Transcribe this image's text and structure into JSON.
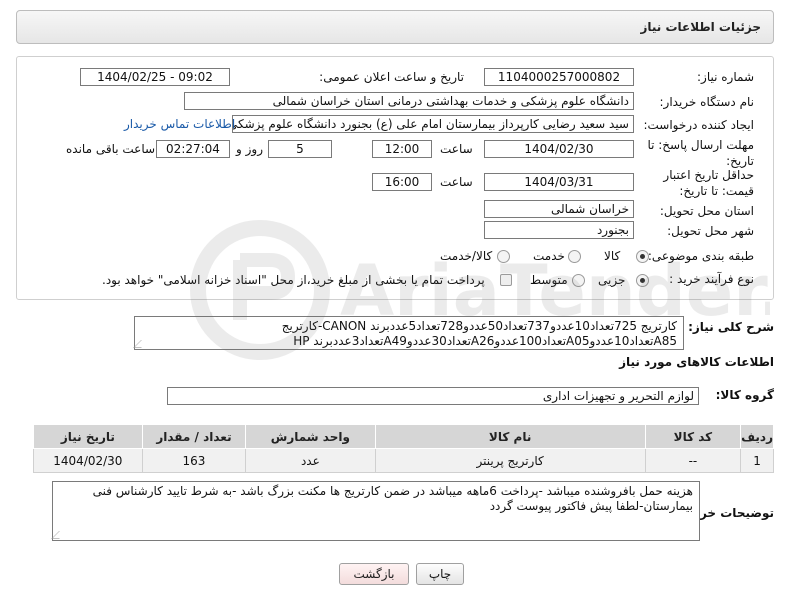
{
  "header": {
    "title": "جزئیات اطلاعات نیاز"
  },
  "form": {
    "need_number": {
      "label": "شماره نیاز:",
      "value": "1104000257000802"
    },
    "announce": {
      "label": "تاریخ و ساعت اعلان عمومی:",
      "value": "1404/02/25 - 09:02"
    },
    "buyer": {
      "label": "نام دستگاه خریدار:",
      "value": "دانشگاه علوم پزشکی و خدمات بهداشتی درمانی استان خراسان شمالی"
    },
    "requester": {
      "label": "ایجاد کننده درخواست:",
      "value": "سید سعید رضایی کارپرداز بیمارستان امام علی (ع) بجنورد دانشگاه علوم پزشکی و",
      "link": "اطلاعات تماس خریدار"
    },
    "deadline": {
      "label": "مهلت ارسال پاسخ: تا تاریخ:",
      "date": "1404/02/30",
      "time_label": "ساعت",
      "time": "12:00",
      "days": "5",
      "days_label": "روز و",
      "remaining": "02:27:04",
      "remaining_label": "ساعت باقی مانده"
    },
    "validity": {
      "label": "حداقل تاریخ اعتبار قیمت: تا تاریخ:",
      "date": "1404/03/31",
      "time_label": "ساعت",
      "time": "16:00"
    },
    "province": {
      "label": "استان محل تحویل:",
      "value": "خراسان شمالی"
    },
    "city": {
      "label": "شهر محل تحویل:",
      "value": "بجنورد"
    },
    "category": {
      "label": "طبقه بندی موضوعی:",
      "options": [
        "کالا",
        "خدمت",
        "کالا/خدمت"
      ],
      "selected": "کالا"
    },
    "process": {
      "label": "نوع فرآیند خرید :",
      "options": [
        "جزیی",
        "متوسط"
      ],
      "selected": "جزیی",
      "note": "پرداخت تمام یا بخشی از مبلغ خرید،از محل \"اسناد خزانه اسلامی\" خواهد بود."
    }
  },
  "summary": {
    "label": "شرح کلی نیاز:",
    "text": "کارتریج 725تعداد10عددو737تعداد50عددو728تعداد5عددبرند CANON-کارتریج A85تعداد10عددوA05تعداد100عددوA26تعداد30عددوA49تعداد3عددبرند HP"
  },
  "goods": {
    "section_title": "اطلاعات کالاهای مورد نیاز",
    "group_label": "گروه کالا:",
    "group_value": "لوازم التحریر و تجهیزات اداری",
    "columns": [
      "ردیف",
      "کد کالا",
      "نام کالا",
      "واحد شمارش",
      "تعداد / مقدار",
      "تاریخ نیاز"
    ],
    "rows": [
      {
        "index": "1",
        "code": "--",
        "name": "کارتریج پرینتر",
        "unit": "عدد",
        "qty": "163",
        "date": "1404/02/30"
      }
    ]
  },
  "buyer_notes": {
    "label": "توضیحات خریدار:",
    "text": "هزینه حمل بافروشنده میباشد -پرداخت 6ماهه میباشد در ضمن کارتریج ها مکنت بزرگ باشد -به شرط تایید کارشناس فنی بیمارستان-لطفا پیش فاکتور پیوست گردد"
  },
  "actions": {
    "print": "چاپ",
    "back": "بازگشت"
  },
  "watermark": {
    "text": "AriaTender.net"
  }
}
